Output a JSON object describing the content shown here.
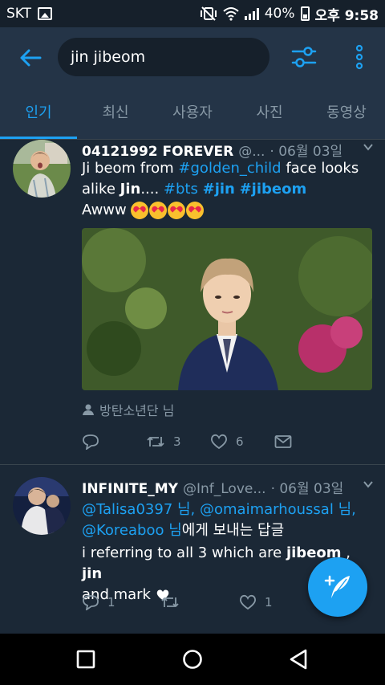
{
  "status_bar": {
    "carrier": "SKT",
    "battery": "40%",
    "time": "오후 9:58"
  },
  "search": {
    "query": "jin jibeom"
  },
  "tabs": [
    {
      "label": "인기",
      "active": true
    },
    {
      "label": "최신",
      "active": false
    },
    {
      "label": "사용자",
      "active": false
    },
    {
      "label": "사진",
      "active": false
    },
    {
      "label": "동영상",
      "active": false
    }
  ],
  "tweets": [
    {
      "name": "04121992 FOREVER",
      "handle": "@...",
      "date": "· 06월 03일",
      "text": {
        "p1": "Ji beom from ",
        "h1": "#golden_child",
        "p2": " face looks alike ",
        "b1": "Jin",
        "p3": ".... ",
        "h2": "#bts",
        "h3": "#jin",
        "h4": "#jibeom",
        "line3": "Awww"
      },
      "retweeted_by": "방탄소년단 님",
      "reply_count": "",
      "retweet_count": "3",
      "like_count": "6"
    },
    {
      "name": "INFINITE_MY",
      "handle": "@Inf_Love...",
      "date": "· 06월 03일",
      "mentions": {
        "m1": "@Talisa0397 님, ",
        "m2": "@omaimarhoussal 님,",
        "m3": "@Koreaboo 님",
        "suffix": "에게 보내는 답글"
      },
      "text": {
        "p1": "i referring to all 3 which are ",
        "b1": "jibeom",
        "p2": " , ",
        "b2": "jin",
        "p3": "and mark"
      },
      "reply_count": "1",
      "retweet_count": "",
      "like_count": "1"
    }
  ],
  "colors": {
    "accent": "#1da1f2",
    "background": "#1b2836",
    "header": "#243447",
    "muted": "#8899a6"
  },
  "icons": [
    "back-arrow-icon",
    "filter-icon",
    "more-vertical-icon",
    "reply-icon",
    "retweet-icon",
    "like-icon",
    "dm-icon",
    "compose-icon"
  ]
}
